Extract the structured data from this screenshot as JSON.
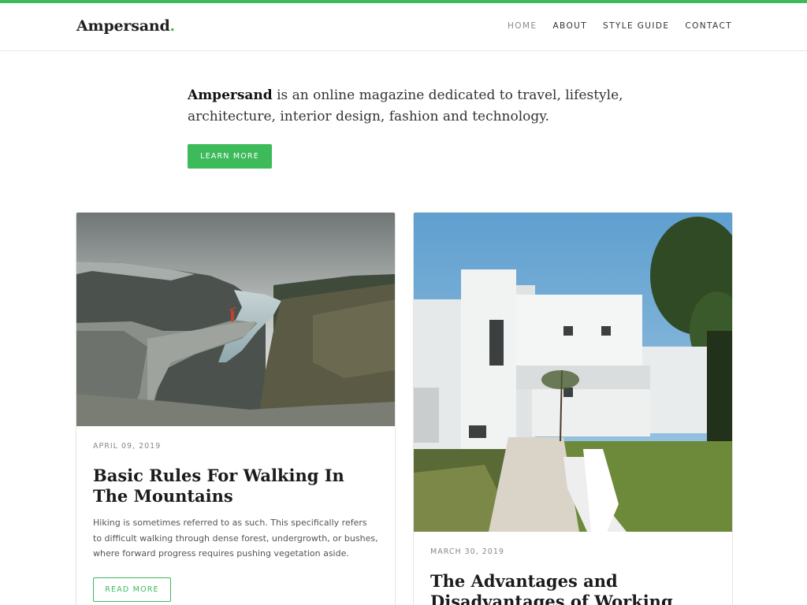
{
  "site": {
    "logo_text": "Ampersand",
    "logo_dot": ".",
    "accent_color": "#3dba5a"
  },
  "nav": {
    "items": [
      {
        "label": "HOME",
        "active": true
      },
      {
        "label": "ABOUT",
        "active": false
      },
      {
        "label": "STYLE GUIDE",
        "active": false
      },
      {
        "label": "CONTACT",
        "active": false
      }
    ]
  },
  "intro": {
    "brand": "Ampersand",
    "text": " is an online magazine dedicated to travel, lifestyle, architecture, interior design, fashion and technology.",
    "button_label": "LEARN MORE"
  },
  "posts": [
    {
      "date": "APRIL 09, 2019",
      "title": "Basic Rules For Walking In The Mountains",
      "excerpt": "Hiking is sometimes referred to as such. This specifically refers to difficult walking through dense forest, undergrowth, or bushes, where forward progress requires pushing vegetation aside.",
      "button_label": "READ MORE",
      "image": "mountain-cliff-photo"
    },
    {
      "date": "MARCH 30, 2019",
      "title": "The Advantages and Disadvantages of Working from",
      "image": "white-house-photo"
    }
  ]
}
